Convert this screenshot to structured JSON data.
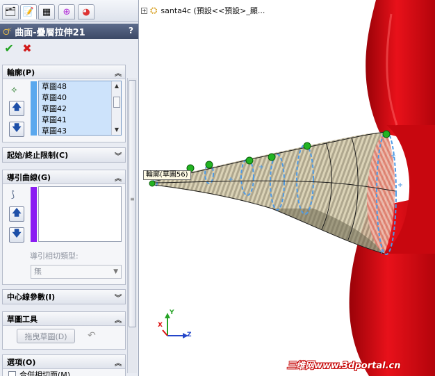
{
  "feature": {
    "title": "曲面-疊層拉伸21",
    "help": "?"
  },
  "actions": {
    "ok": "✔",
    "cancel": "✖"
  },
  "profiles": {
    "label": "輪廓(P)",
    "items": [
      "草圖48",
      "草圖40",
      "草圖42",
      "草圖41",
      "草圖43"
    ]
  },
  "start_end": {
    "label": "起始/終止限制(C)"
  },
  "guides": {
    "label": "導引曲線(G)",
    "tangency_label": "導引相切類型:",
    "tangency_value": "無"
  },
  "centerline": {
    "label": "中心線參數(I)"
  },
  "sketch_tools": {
    "label": "草圖工具",
    "drag_button": "拖曳草圖(D)"
  },
  "options": {
    "label": "選項(O)",
    "first_option": "合併相切面(M)"
  },
  "viewport": {
    "tree_root": "santa4c (預設<<預設>_顯...",
    "callout": "輪廓(草圖56)",
    "watermark": "三维网www.3dportal.cn",
    "axes": {
      "x": "X",
      "y": "Y",
      "z": "Z"
    }
  },
  "colors": {
    "accent_profile": "#5aa8ee",
    "accent_guide": "#8a1cf2",
    "model_red": "#e20f17",
    "header_bg": "#47546f"
  }
}
